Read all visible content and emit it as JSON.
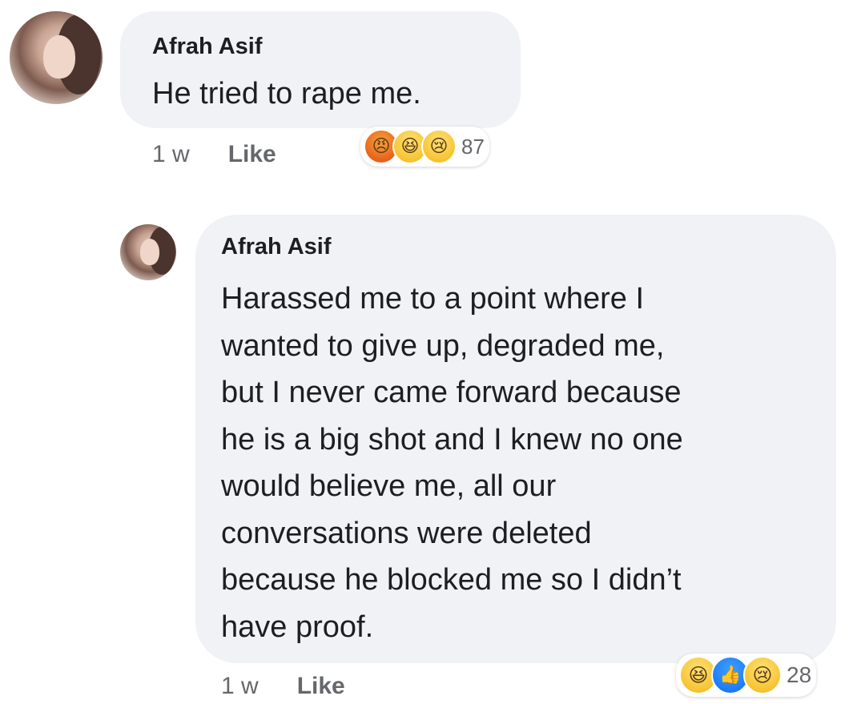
{
  "comments": [
    {
      "author": "Afrah Asif",
      "text": "He tried to rape me.",
      "time": "1 w",
      "like_label": "Like",
      "reactions": {
        "icons": [
          "angry-reaction-icon",
          "haha-reaction-icon",
          "sad-reaction-icon"
        ],
        "glyphs": [
          "😠",
          "😆",
          "😢"
        ],
        "count": "87"
      }
    },
    {
      "author": "Afrah Asif",
      "text": "Harassed me to a point where I\nwanted to give up, degraded me,\nbut I never came forward because\nhe is a big shot and I knew no one\nwould believe me, all our\nconversations were deleted\nbecause he blocked me so I didn’t\nhave proof.",
      "time": "1 w",
      "like_label": "Like",
      "reactions": {
        "icons": [
          "haha-reaction-icon",
          "like-reaction-icon",
          "sad-reaction-icon"
        ],
        "glyphs": [
          "😆",
          "👍",
          "😢"
        ],
        "count": "28"
      }
    }
  ],
  "colors": {
    "bubble": "#f0f2f5",
    "meta_text": "#65676b",
    "like_blue": "#1877f2",
    "angry_orange": "#e8621b",
    "yellow": "#f6c22c"
  }
}
